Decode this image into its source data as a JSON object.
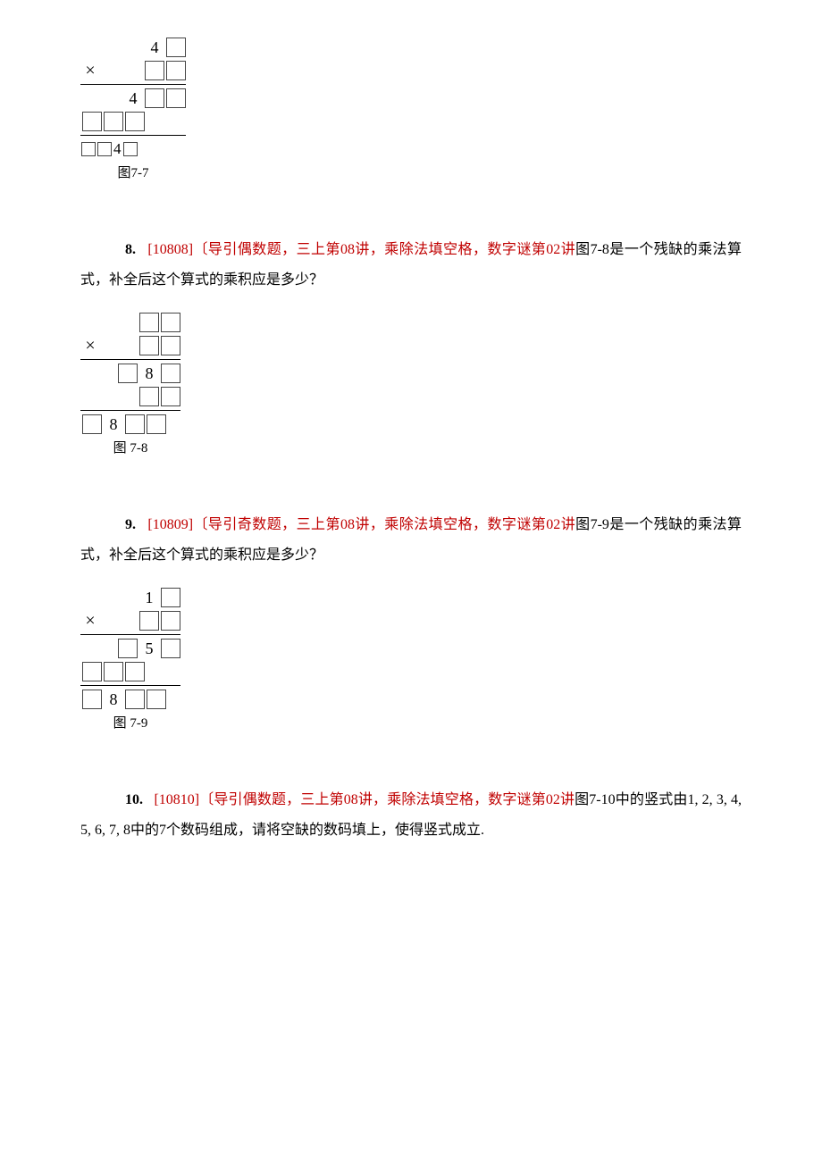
{
  "fig77": {
    "caption": "图7-7",
    "r1_d": "4",
    "r2_sym": "×",
    "r3_d": "4",
    "r5_d": "4"
  },
  "p8": {
    "num": "8.",
    "tag": "[10808]〔导引偶数题，三上第08讲，乘除法填空格，数字谜第02讲",
    "tail": "图7-8是一个残缺的乘法算式，补全后这个算式的乘积应是多少？"
  },
  "fig78": {
    "caption": "图 7-8",
    "sym": "×",
    "r3_d": "8",
    "r5_d": "8"
  },
  "p9": {
    "num": "9.",
    "tag": "[10809]〔导引奇数题，三上第08讲，乘除法填空格，数字谜第02讲",
    "tail": "图7-9是一个残缺的乘法算式，补全后这个算式的乘积应是多少？"
  },
  "fig79": {
    "caption": "图 7-9",
    "sym": "×",
    "r1_d": "1",
    "r3_d": "5",
    "r5_d": "8"
  },
  "p10": {
    "num": "10.",
    "tag": "[10810]〔导引偶数题，三上第08讲，乘除法填空格，数字谜第02讲",
    "tail": "图7-10中的竖式由1, 2, 3, 4, 5, 6, 7, 8中的7个数码组成，请将空缺的数码填上，使得竖式成立."
  }
}
